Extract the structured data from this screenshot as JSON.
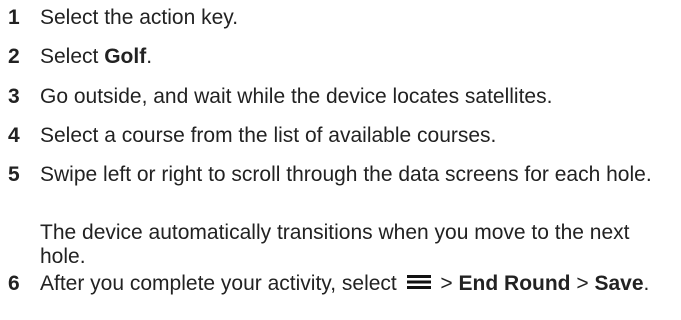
{
  "steps": [
    {
      "num": "1",
      "text": "Select the action key."
    },
    {
      "num": "2",
      "pre": "Select ",
      "bold": "Golf",
      "post": "."
    },
    {
      "num": "3",
      "text": "Go outside, and wait while the device locates satellites."
    },
    {
      "num": "4",
      "text": "Select a course from the list of available courses."
    },
    {
      "num": "5",
      "text": "Swipe left or right to scroll through the data screens for each hole."
    },
    {
      "num": "6",
      "pre": "After you complete your activity, select ",
      "sep1": " > ",
      "bold1": "End Round",
      "sep2": " > ",
      "bold2": "Save",
      "post": "."
    }
  ],
  "note": "The device automatically transitions when you move to the next hole.",
  "icons": {
    "menu": "menu-icon"
  }
}
